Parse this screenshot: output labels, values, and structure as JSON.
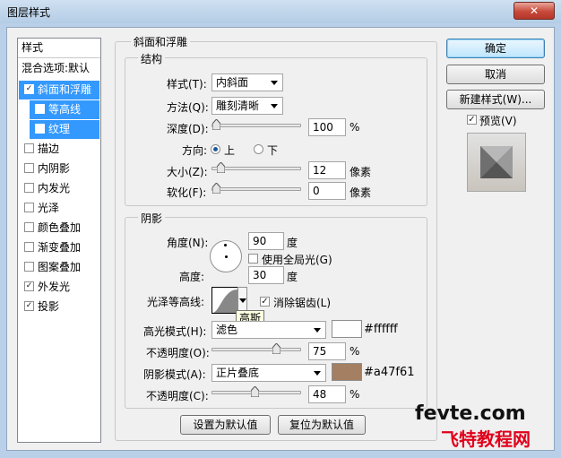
{
  "window": {
    "title": "图层样式",
    "close": "✕"
  },
  "left": {
    "header": "样式",
    "blending": "混合选项:默认",
    "items": [
      {
        "label": "斜面和浮雕",
        "checked": true
      },
      {
        "label": "等高线",
        "checked": false
      },
      {
        "label": "纹理",
        "checked": false
      },
      {
        "label": "描边",
        "checked": false
      },
      {
        "label": "内阴影",
        "checked": false
      },
      {
        "label": "内发光",
        "checked": false
      },
      {
        "label": "光泽",
        "checked": false
      },
      {
        "label": "颜色叠加",
        "checked": false
      },
      {
        "label": "渐变叠加",
        "checked": false
      },
      {
        "label": "图案叠加",
        "checked": false
      },
      {
        "label": "外发光",
        "checked": true
      },
      {
        "label": "投影",
        "checked": true
      }
    ]
  },
  "bevel": {
    "title": "斜面和浮雕",
    "structure": {
      "title": "结构",
      "style_label": "样式(T):",
      "style_value": "内斜面",
      "technique_label": "方法(Q):",
      "technique_value": "雕刻清晰",
      "depth_label": "深度(D):",
      "depth_value": "100",
      "depth_unit": "%",
      "depth_slider": 0.0,
      "direction_label": "方向:",
      "dir_up": "上",
      "dir_down": "下",
      "size_label": "大小(Z):",
      "size_value": "12",
      "size_unit": "像素",
      "size_slider": 0.06,
      "soften_label": "软化(F):",
      "soften_value": "0",
      "soften_unit": "像素",
      "soften_slider": 0.0
    },
    "shading": {
      "title": "阴影",
      "angle_label": "角度(N):",
      "angle_value": "90",
      "angle_unit": "度",
      "global_light": "使用全局光(G)",
      "altitude_label": "高度:",
      "altitude_value": "30",
      "altitude_unit": "度",
      "gloss_label": "光泽等高线:",
      "antialias": "消除锯齿(L)",
      "tooltip": "高斯",
      "highlight_label": "高光模式(H):",
      "highlight_mode": "滤色",
      "highlight_color": "#ffffff",
      "highlight_hex": "#ffffff",
      "opacity1_label": "不透明度(O):",
      "opacity1_value": "75",
      "opacity1_unit": "%",
      "opacity1_slider": 0.75,
      "shadow_label": "阴影模式(A):",
      "shadow_mode": "正片叠底",
      "shadow_color": "#a47f61",
      "shadow_hex": "#a47f61",
      "opacity2_label": "不透明度(C):",
      "opacity2_value": "48",
      "opacity2_unit": "%",
      "opacity2_slider": 0.48
    },
    "make_default": "设置为默认值",
    "reset_default": "复位为默认值"
  },
  "actions": {
    "ok": "确定",
    "cancel": "取消",
    "new_style": "新建样式(W)...",
    "preview": "预览(V)"
  },
  "watermark": {
    "line1": "fevte.com",
    "line2": "飞特教程网"
  }
}
